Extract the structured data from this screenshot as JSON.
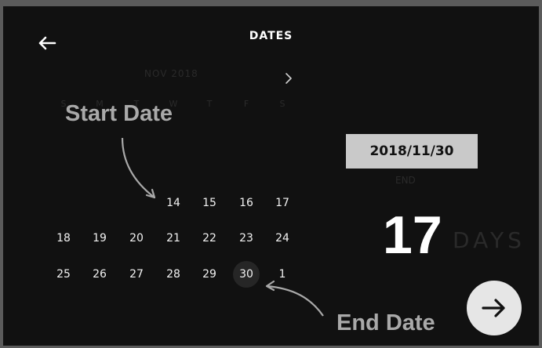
{
  "header": {
    "title": "DATES",
    "back_icon": "arrow-left-icon"
  },
  "calendar": {
    "month_label": "NOV 2018",
    "next_icon": "chevron-right-icon",
    "weekdays": [
      "S",
      "M",
      "T",
      "W",
      "T",
      "F",
      "S"
    ],
    "weeks": [
      [
        "",
        "",
        "",
        "14",
        "15",
        "16",
        "17"
      ],
      [
        "18",
        "19",
        "20",
        "21",
        "22",
        "23",
        "24"
      ],
      [
        "25",
        "26",
        "27",
        "28",
        "29",
        "30",
        "1"
      ]
    ],
    "selected_end": "30"
  },
  "annotations": {
    "start": "Start Date",
    "end": "End Date"
  },
  "summary": {
    "date": "2018/11/30",
    "sublabel": "END",
    "count": "17",
    "unit": "DAYS"
  },
  "actions": {
    "next_icon": "arrow-right-icon"
  }
}
